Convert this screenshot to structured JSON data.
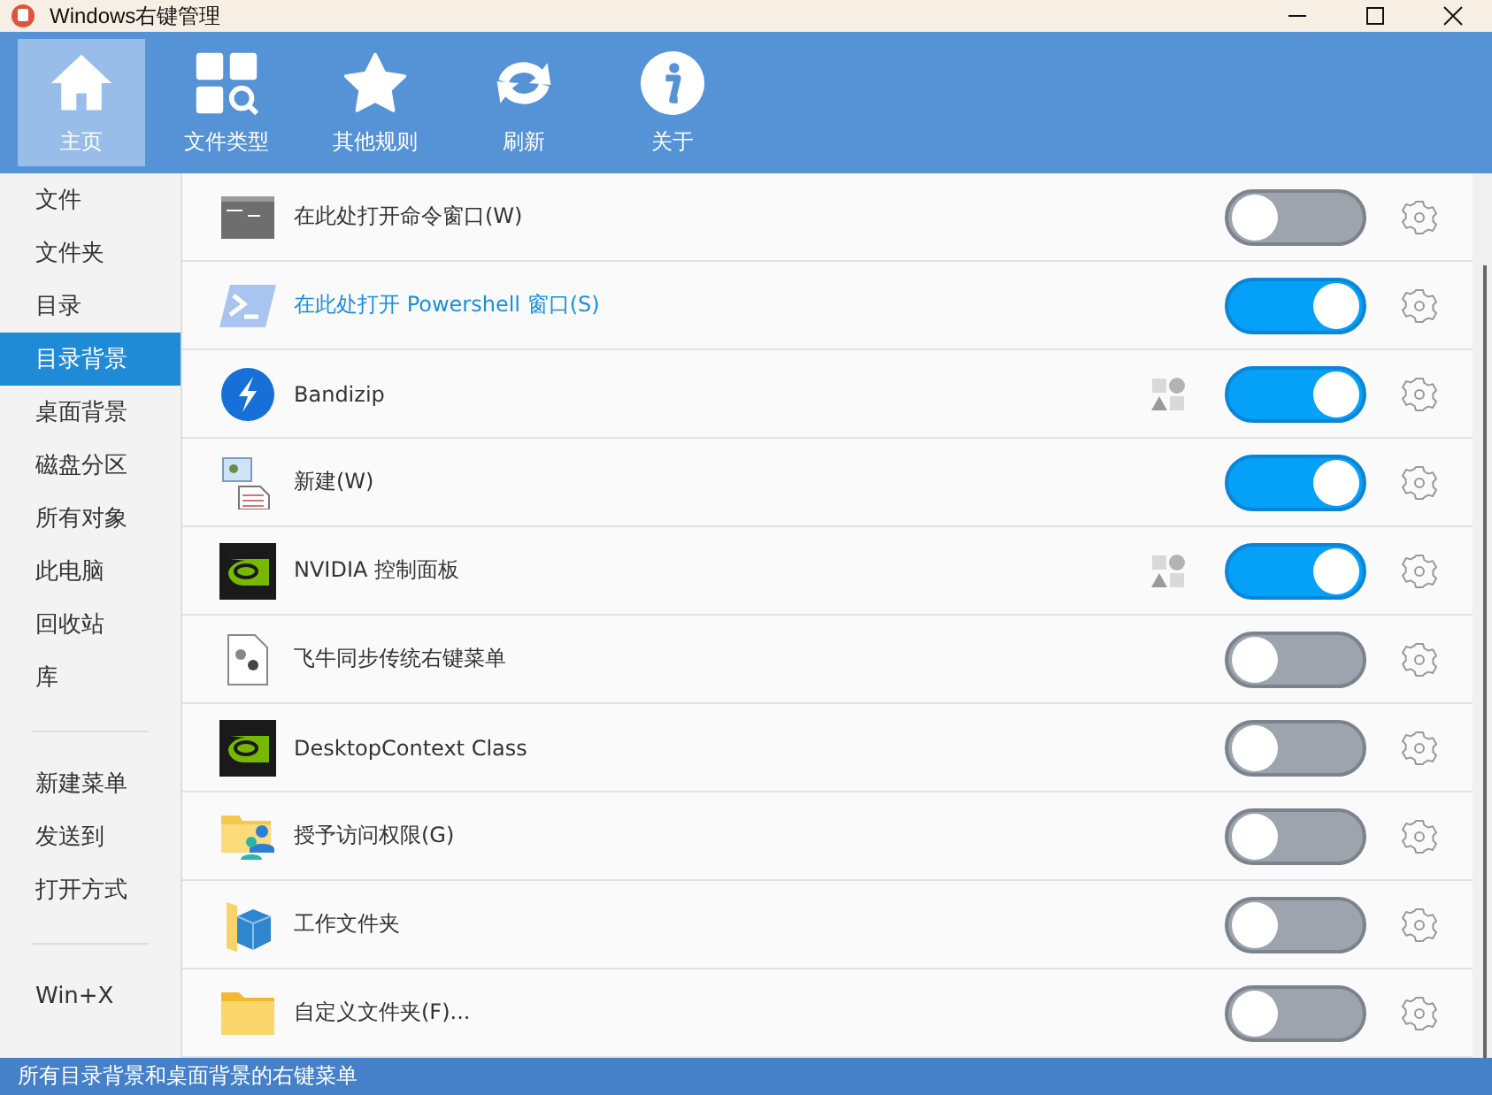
{
  "window": {
    "title": "Windows右键管理"
  },
  "toolbar": [
    {
      "label": "主页",
      "kind": "home",
      "selected": true
    },
    {
      "label": "文件类型",
      "kind": "types",
      "selected": false
    },
    {
      "label": "其他规则",
      "kind": "rules",
      "selected": false
    },
    {
      "label": "刷新",
      "kind": "refresh",
      "selected": false
    },
    {
      "label": "关于",
      "kind": "about",
      "selected": false
    }
  ],
  "sidebar": {
    "groups": [
      [
        {
          "label": "文件",
          "selected": false
        },
        {
          "label": "文件夹",
          "selected": false
        },
        {
          "label": "目录",
          "selected": false
        },
        {
          "label": "目录背景",
          "selected": true
        },
        {
          "label": "桌面背景",
          "selected": false
        },
        {
          "label": "磁盘分区",
          "selected": false
        },
        {
          "label": "所有对象",
          "selected": false
        },
        {
          "label": "此电脑",
          "selected": false
        },
        {
          "label": "回收站",
          "selected": false
        },
        {
          "label": "库",
          "selected": false
        }
      ],
      [
        {
          "label": "新建菜单",
          "selected": false
        },
        {
          "label": "发送到",
          "selected": false
        },
        {
          "label": "打开方式",
          "selected": false
        }
      ],
      [
        {
          "label": "Win+X",
          "selected": false
        }
      ]
    ]
  },
  "items": [
    {
      "label": "在此处打开命令窗口(W)",
      "kind": "terminal",
      "highlighted": false,
      "shared": false,
      "on": false
    },
    {
      "label": "在此处打开 Powershell 窗口(S)",
      "kind": "shell",
      "highlighted": true,
      "shared": false,
      "on": true
    },
    {
      "label": "Bandizip",
      "kind": "archive",
      "highlighted": false,
      "shared": true,
      "on": true
    },
    {
      "label": "新建(W)",
      "kind": "new",
      "highlighted": false,
      "shared": false,
      "on": true
    },
    {
      "label": "NVIDIA 控制面板",
      "kind": "graphics",
      "highlighted": false,
      "shared": true,
      "on": true
    },
    {
      "label": "飞牛同步传统右键菜单",
      "kind": "generic",
      "highlighted": false,
      "shared": false,
      "on": false
    },
    {
      "label": "DesktopContext Class",
      "kind": "graphics",
      "highlighted": false,
      "shared": false,
      "on": false
    },
    {
      "label": "授予访问权限(G)",
      "kind": "access",
      "highlighted": false,
      "shared": false,
      "on": false
    },
    {
      "label": "工作文件夹",
      "kind": "work",
      "highlighted": false,
      "shared": false,
      "on": false
    },
    {
      "label": "自定义文件夹(F)...",
      "kind": "folder",
      "highlighted": false,
      "shared": false,
      "on": false
    }
  ],
  "status_bar": "所有目录背景和桌面背景的右键菜单"
}
